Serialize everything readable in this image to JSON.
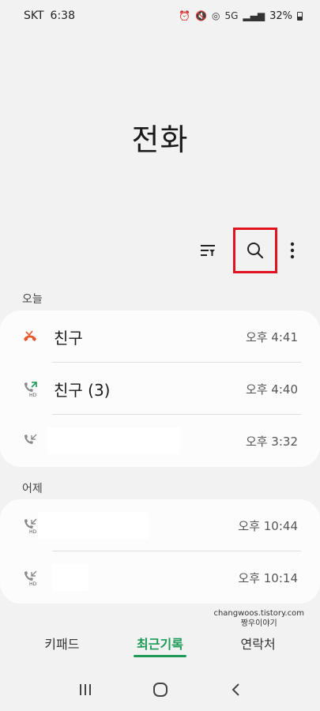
{
  "status": {
    "carrier": "SKT",
    "time": "6:38",
    "network": "5G",
    "battery": "32%"
  },
  "title": "전화",
  "toolbar": {
    "filter_icon": "filter-icon",
    "search_icon": "search-icon",
    "more_icon": "more-vertical-icon"
  },
  "sections": [
    {
      "label": "오늘",
      "rows": [
        {
          "icon": "missed-call-icon",
          "name": "친구",
          "time": "오후 4:41"
        },
        {
          "icon": "outgoing-hd-call-icon",
          "name": "친구 (3)",
          "time": "오후 4:40"
        },
        {
          "icon": "incoming-call-icon",
          "name": "",
          "time": "오후 3:32"
        }
      ]
    },
    {
      "label": "어제",
      "rows": [
        {
          "icon": "incoming-hd-call-icon",
          "name": "",
          "time": "오후 10:44"
        },
        {
          "icon": "incoming-hd-call-icon",
          "name": "",
          "time": "오후 10:14"
        }
      ]
    }
  ],
  "tabs": [
    {
      "label": "키패드",
      "active": false
    },
    {
      "label": "최근기록",
      "active": true
    },
    {
      "label": "연락처",
      "active": false
    }
  ],
  "watermark": {
    "line1": "changwoos.tistory.com",
    "line2": "짱우이야기"
  },
  "colors": {
    "accent": "#1d9a55",
    "missed": "#e8572b",
    "highlight": "#e0141e"
  }
}
